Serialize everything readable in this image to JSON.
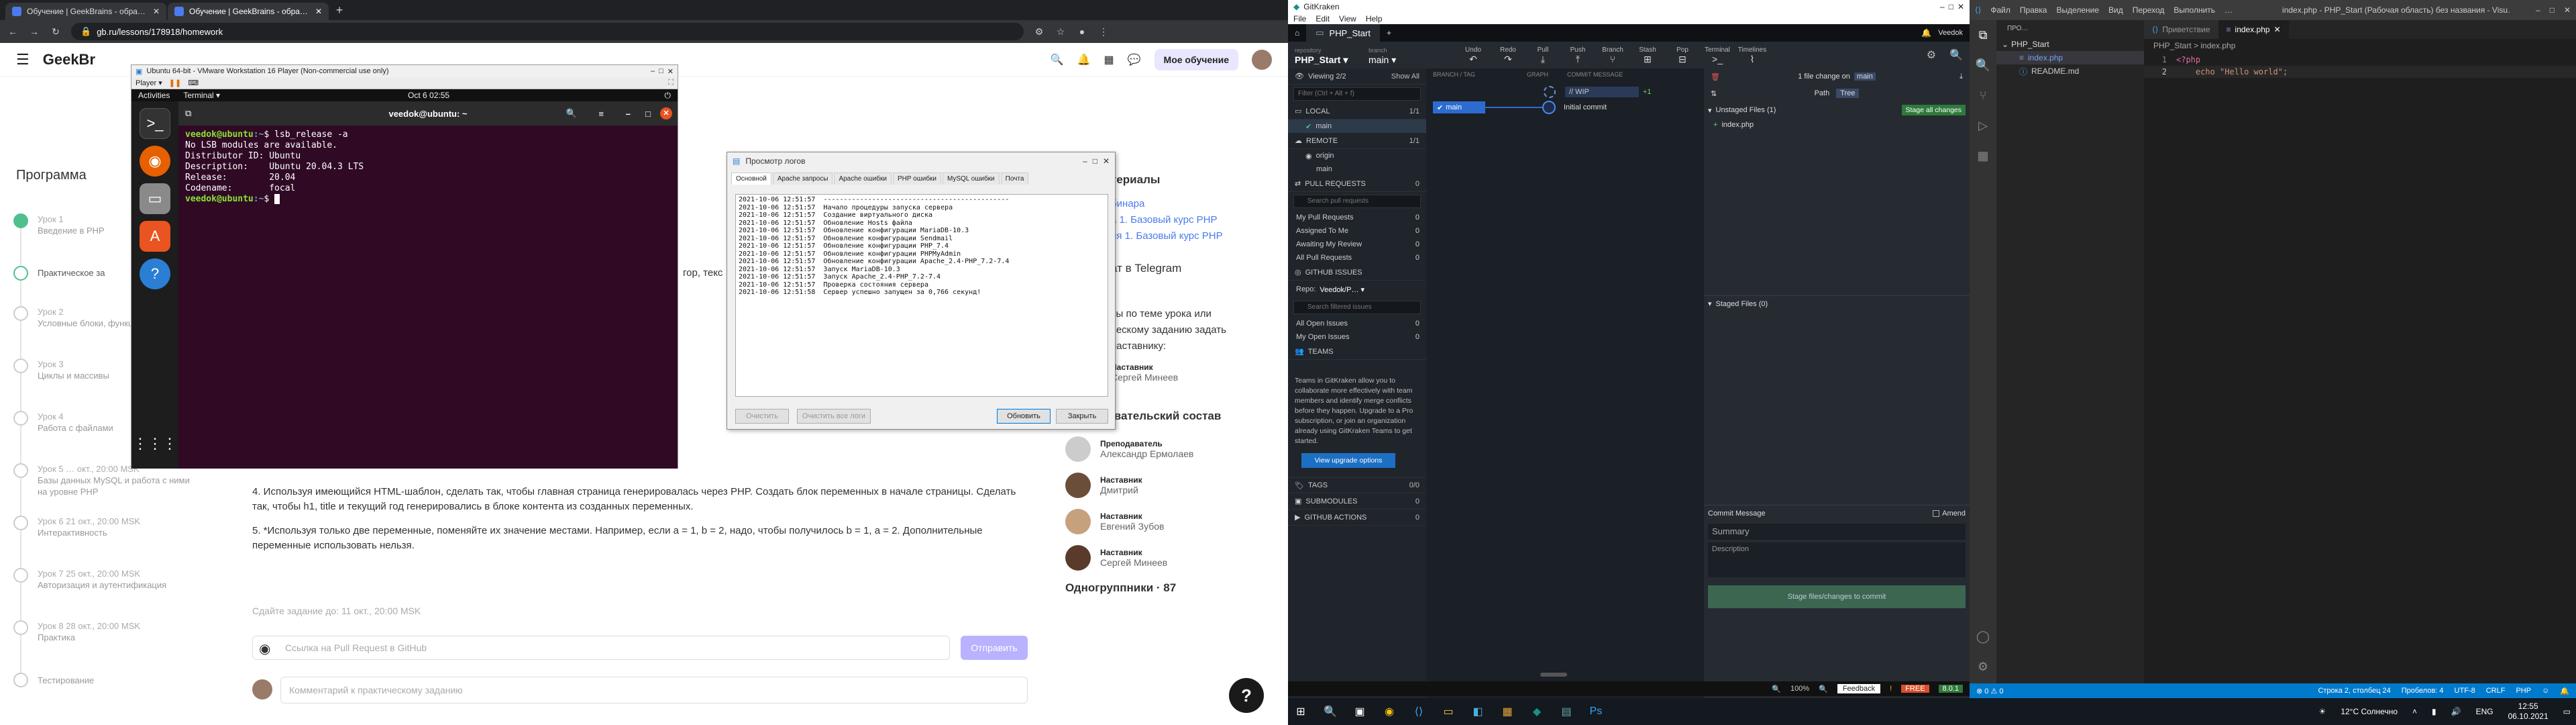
{
  "browser": {
    "tabs": [
      {
        "title": "Обучение | GeekBrains - образ…",
        "active": false
      },
      {
        "title": "Обучение | GeekBrains - образ…",
        "active": true
      }
    ],
    "url": "gb.ru/lessons/178918/homework",
    "header": {
      "logo": "GeekBr",
      "my_learning": "Мое обучение"
    }
  },
  "program": {
    "title": "Программа",
    "lessons": [
      {
        "num": "Урок 1",
        "name": "Введение в PHP",
        "state": "done"
      },
      {
        "num": "",
        "name": "Практическое за",
        "state": "current"
      },
      {
        "num": "Урок 2",
        "name": "Условные блоки, функции",
        "state": "todo"
      },
      {
        "num": "Урок 3",
        "name": "Циклы и массивы",
        "state": "todo"
      },
      {
        "num": "Урок 4",
        "name": "Работа с файлами",
        "state": "todo"
      },
      {
        "num": "Урок 5  …  окт., 20:00 MSK",
        "name": "Базы данных MySQL и работа с ними на уровне PHP",
        "state": "todo"
      },
      {
        "num": "Урок 6  21 окт., 20:00 MSK",
        "name": "Интерактивность",
        "state": "todo"
      },
      {
        "num": "Урок 7  25 окт., 20:00 MSK",
        "name": "Авторизация и аутентификация",
        "state": "todo"
      },
      {
        "num": "Урок 8  28 окт., 20:00 MSK",
        "name": "Практика",
        "state": "todo"
      },
      {
        "num": "",
        "name": "Тестирование",
        "state": "todo"
      }
    ]
  },
  "homework": {
    "task4": "4. Используя имеющийся HTML-шаблон, сделать так, чтобы главная страница генерировалась через PHP. Создать блок переменных в начале страницы. Сделать так, чтобы h1, title и текущий год генерировались в блоке контента из созданных переменных.",
    "task5": "5. *Используя только две переменные, поменяйте их значение местами. Например, если a = 1, b = 2, надо, чтобы получилось b = 1, a = 2. Дополнительные переменные использовать нельзя.",
    "deadline": "Сдайте задание до: 11 окт., 20:00 MSK",
    "pr_placeholder": "Ссылка на Pull Request в GitHub",
    "submit": "Отправить",
    "comment_placeholder": "Комментарий к практическому заданию",
    "partial_text": "гор, текс"
  },
  "rightcol": {
    "materials": "териалы",
    "links": [
      "бинара",
      "а 1. Базовый курс PHP",
      "ия 1. Базовый курс PHP"
    ],
    "telegram": "ат в Telegram",
    "questions": "сы по теме урока или ческому заданию задать наставнику:",
    "mentor_top": {
      "role": "Наставник",
      "name": "Сергей Минеев"
    },
    "staff_title": "Преподавательский состав",
    "staff": [
      {
        "role": "Преподаватель",
        "name": "Александр Ермолаев"
      },
      {
        "role": "Наставник",
        "name": "Дмитрий"
      },
      {
        "role": "Наставник",
        "name": "Евгений Зубов"
      },
      {
        "role": "Наставник",
        "name": "Сергей Минеев"
      }
    ],
    "groupmates": "Одногруппники · 87"
  },
  "vmware": {
    "title": "Ubuntu 64-bit - VMware Workstation 16 Player (Non-commercial use only)",
    "player_menu": "Player ▾",
    "ubuntu_activities": "Activities",
    "ubuntu_app": "Terminal ▾",
    "ubuntu_clock": "Oct 6  02:55",
    "terminal_title": "veedok@ubuntu: ~",
    "prompt_user": "veedok@ubuntu",
    "prompt_path": ":~",
    "prompt_sym": "$",
    "cmd": " lsb_release -a",
    "output": "No LSB modules are available.\nDistributor ID:\tUbuntu\nDescription:\tUbuntu 20.04.3 LTS\nRelease:\t20.04\nCodename:\tfocal"
  },
  "logwin": {
    "title": "Просмотр логов",
    "tabs": [
      "Основной",
      "Apache запросы",
      "Apache ошибки",
      "PHP ошибки",
      "MySQL ошибки",
      "Почта"
    ],
    "log": "2021-10-06 12:51:57  ----------------------------------------------\n2021-10-06 12:51:57  Начало процедуры запуска сервера\n2021-10-06 12:51:57  Создание виртуального диска\n2021-10-06 12:51:57  Обновление Hosts файла\n2021-10-06 12:51:57  Обновление конфигурации MariaDB-10.3\n2021-10-06 12:51:57  Обновление конфигурации Sendmail\n2021-10-06 12:51:57  Обновление конфигурации PHP_7.4\n2021-10-06 12:51:57  Обновление конфигурации PHPMyAdmin\n2021-10-06 12:51:57  Обновление конфигурации Apache_2.4-PHP_7.2-7.4\n2021-10-06 12:51:57  Запуск MariaDB-10.3\n2021-10-06 12:51:57  Запуск Apache_2.4-PHP_7.2-7.4\n2021-10-06 12:51:57  Проверка состояния сервера\n2021-10-06 12:51:58  Сервер успешно запущен за 0,766 секунд!",
    "btn_clear": "Очистить",
    "btn_clear_all": "Очистить все логи",
    "btn_refresh": "Обновить",
    "btn_close": "Закрыть"
  },
  "gitkraken": {
    "title": "GitKraken",
    "menu": [
      "File",
      "Edit",
      "View",
      "Help"
    ],
    "repo_tab": "PHP_Start",
    "repository": "PHP_Start ▾",
    "branch": "main ▾",
    "toolbar": [
      "Undo",
      "Redo",
      "Pull",
      "Push",
      "Branch",
      "Stash",
      "Pop",
      "Terminal",
      "Timelines"
    ],
    "profile": "Veedok",
    "viewing": "Viewing 2/2",
    "show_all": "Show All",
    "filter": "Filter (Ctrl + Alt + f)",
    "sections": {
      "local": {
        "label": "LOCAL",
        "count": "1/1"
      },
      "local_branch": "main",
      "remote": {
        "label": "REMOTE",
        "count": "1/1"
      },
      "origin": "origin",
      "origin_branch": "main",
      "pull_requests": {
        "label": "PULL REQUESTS",
        "count": "0"
      },
      "search_pr": "Search pull requests",
      "pr_items": [
        {
          "label": "My Pull Requests",
          "count": "0"
        },
        {
          "label": "Assigned To Me",
          "count": "0"
        },
        {
          "label": "Awaiting My Review",
          "count": "0"
        },
        {
          "label": "All Pull Requests",
          "count": "0"
        }
      ],
      "github_issues": "GITHUB ISSUES",
      "repo_label": "Repo:",
      "repo_value": "Veedok/P… ▾",
      "search_issues": "Search filtered issues",
      "issue_items": [
        {
          "label": "All Open Issues",
          "count": "0"
        },
        {
          "label": "My Open Issues",
          "count": "0"
        }
      ],
      "teams": "TEAMS",
      "teams_text": "Teams in GitKraken allow you to collaborate more effectively with team members and identify merge conflicts before they happen. Upgrade to a Pro subscription, or join an organization already using GitKraken Teams to get started.",
      "upgrade": "View upgrade options",
      "tags": {
        "label": "TAGS",
        "count": "0/0"
      },
      "submodules": {
        "label": "SUBMODULES",
        "count": "0"
      },
      "github_actions": {
        "label": "GITHUB ACTIONS",
        "count": "0"
      }
    },
    "graph_header": [
      "BRANCH / TAG",
      "GRAPH",
      "COMMIT MESSAGE"
    ],
    "wip": "// WIP",
    "wip_badge": "+1",
    "branch_badge": "main",
    "commit": "Initial commit",
    "detail": {
      "file_change": "1 file change on",
      "branch": "main",
      "path": "Path",
      "tree": "Tree",
      "unstaged": "Unstaged Files (1)",
      "stage_all": "Stage all changes",
      "file": "index.php",
      "staged": "Staged Files (0)",
      "commit_message": "Commit Message",
      "amend": "Amend",
      "summary": "Summary",
      "description": "Description",
      "stage_btn": "Stage files/changes to commit"
    },
    "status": {
      "zoom": "100%",
      "feedback": "Feedback",
      "free": "FREE",
      "version": "8.0.1"
    }
  },
  "taskbar": {
    "weather": "12°C  Солнечно",
    "lang": "ENG",
    "time": "12:55",
    "date": "06.10.2021"
  },
  "vscode": {
    "menu": [
      "Файл",
      "Правка",
      "Выделение",
      "Вид",
      "Переход",
      "Выполнить",
      "…"
    ],
    "title": "index.php - PHP_Start (Рабочая область) без названия - Visu…",
    "explorer_title": "ПРО…",
    "folder": "PHP_Start",
    "files": [
      "index.php",
      "README.md"
    ],
    "tab_welcome": "Приветствие",
    "tab_file": "index.php",
    "breadcrumb": "PHP_Start  >  index.php",
    "lines": [
      {
        "n": "1",
        "code": "<?php"
      },
      {
        "n": "2",
        "code": "    echo \"Hello world\";"
      }
    ],
    "status": [
      "⊗ 0  ⚠ 0",
      "Строка 2, столбец 24",
      "Пробелов: 4",
      "UTF-8",
      "CRLF",
      "PHP"
    ]
  }
}
